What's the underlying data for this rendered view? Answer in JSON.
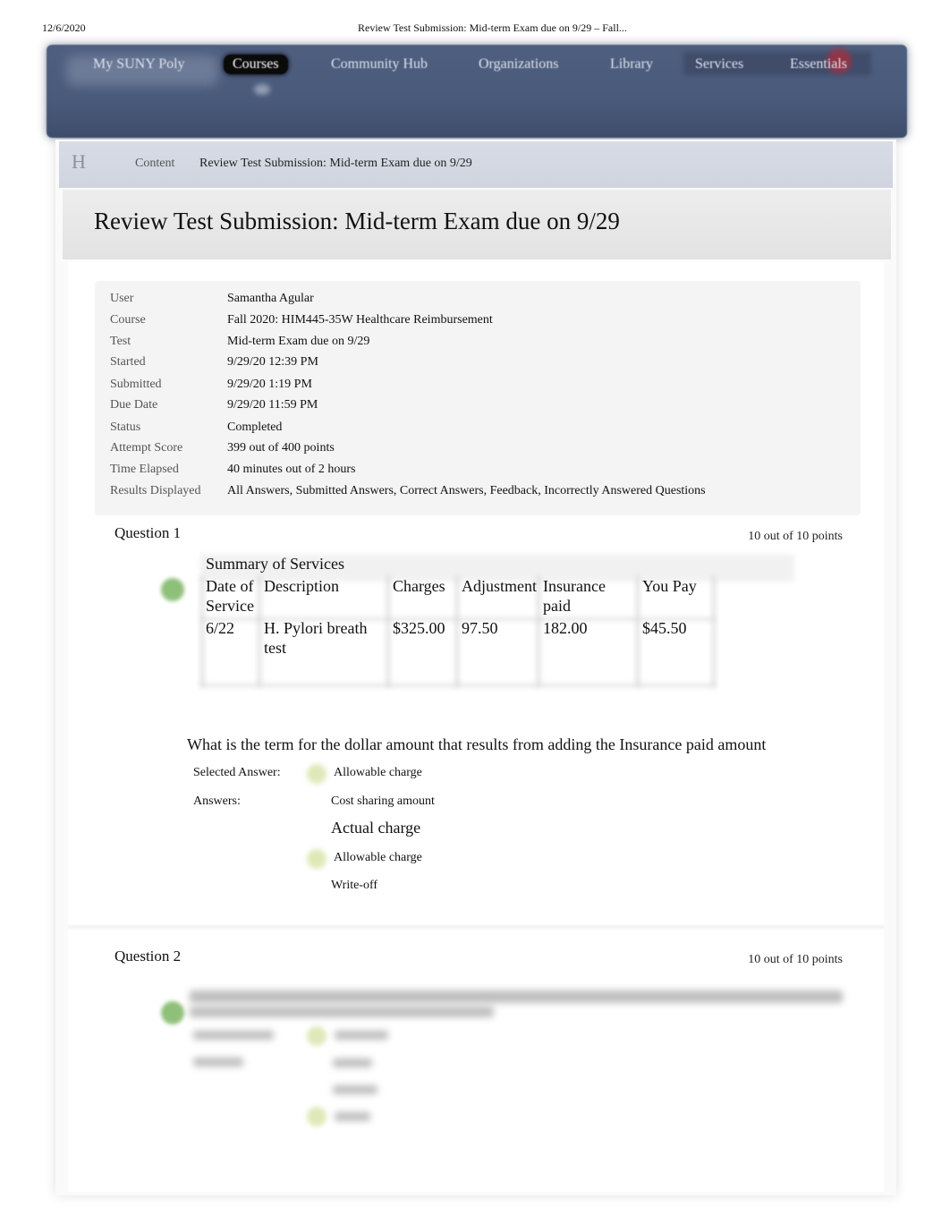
{
  "print_header": {
    "date": "12/6/2020",
    "title": "Review Test Submission: Mid-term Exam due on 9/29 – Fall..."
  },
  "nav": {
    "items": [
      {
        "label": "My SUNY Poly",
        "active": false
      },
      {
        "label": "Courses",
        "active": true
      },
      {
        "label": "Community Hub",
        "active": false
      },
      {
        "label": "Organizations",
        "active": false
      },
      {
        "label": "Library",
        "active": false
      },
      {
        "label": "Services",
        "active": false
      },
      {
        "label": "Essentials",
        "active": false
      }
    ],
    "colors": {
      "bar": "#4a5a7b",
      "active_bg": "#0a0a0a",
      "badge": "#a33040"
    }
  },
  "breadcrumb": {
    "home_icon": "H",
    "items": [
      "Content",
      "Review Test Submission: Mid-term Exam due on 9/29"
    ]
  },
  "page_title": "Review Test Submission: Mid-term Exam due on 9/29",
  "submission_info": [
    {
      "label": "User",
      "value": "Samantha Agular"
    },
    {
      "label": "Course",
      "value": "Fall 2020: HIM445-35W Healthcare Reimbursement"
    },
    {
      "label": "Test",
      "value": "Mid-term Exam due on 9/29"
    },
    {
      "label": "Started",
      "value": "9/29/20 12:39 PM"
    },
    {
      "label": "Submitted",
      "value": "9/29/20 1:19 PM"
    },
    {
      "label": "Due Date",
      "value": "9/29/20 11:59 PM"
    },
    {
      "label": "Status",
      "value": "Completed"
    },
    {
      "label": "Attempt Score",
      "value": "399 out of 400 points"
    },
    {
      "label": "Time Elapsed",
      "value": "40 minutes out of 2 hours"
    },
    {
      "label": "Results Displayed",
      "value": "All Answers, Submitted Answers, Correct Answers, Feedback, Incorrectly Answered Questions"
    }
  ],
  "questions": [
    {
      "title": "Question 1",
      "points": "10 out of 10 points",
      "status_icon": "correct-check-icon",
      "summary_table": {
        "caption": "Summary of Services",
        "headers": [
          "Date of Service",
          "Description",
          "Charges",
          "Adjustment",
          "Insurance paid",
          "You Pay"
        ],
        "header_lines": [
          [
            "Date of",
            "Service"
          ],
          [
            "Description"
          ],
          [
            "Charges"
          ],
          [
            "Adjustment"
          ],
          [
            "Insurance",
            "paid"
          ],
          [
            "You Pay"
          ]
        ],
        "rows": [
          {
            "cells": [
              "6/22",
              "H. Pylori breath test",
              "$325.00",
              "97.50",
              "182.00",
              "$45.50"
            ],
            "lines": [
              [
                "6/22"
              ],
              [
                "H. Pylori breath",
                "test"
              ],
              [
                "$325.00"
              ],
              [
                "97.50"
              ],
              [
                "182.00"
              ],
              [
                "$45.50"
              ]
            ]
          }
        ]
      },
      "text": "What is the term for the dollar amount that results from adding the Insurance paid amount",
      "selected_answer_label": "Selected Answer:",
      "selected_answer": "Allowable charge",
      "answers_label": "Answers:",
      "answers": [
        {
          "text": "Cost sharing amount",
          "correct": false
        },
        {
          "text": "Actual charge",
          "correct": false
        },
        {
          "text": "Allowable charge",
          "correct": true
        },
        {
          "text": "Write-off",
          "correct": false
        }
      ]
    },
    {
      "title": "Question 2",
      "points": "10 out of 10 points",
      "status_icon": "correct-check-icon",
      "text_blurred": true
    }
  ],
  "colors": {
    "correct_icon": "#8fc07a",
    "answer_marker": "#dfe8b8",
    "breadcrumb_bg": "#d3d8e2",
    "info_box_bg": "#f4f4f4"
  }
}
